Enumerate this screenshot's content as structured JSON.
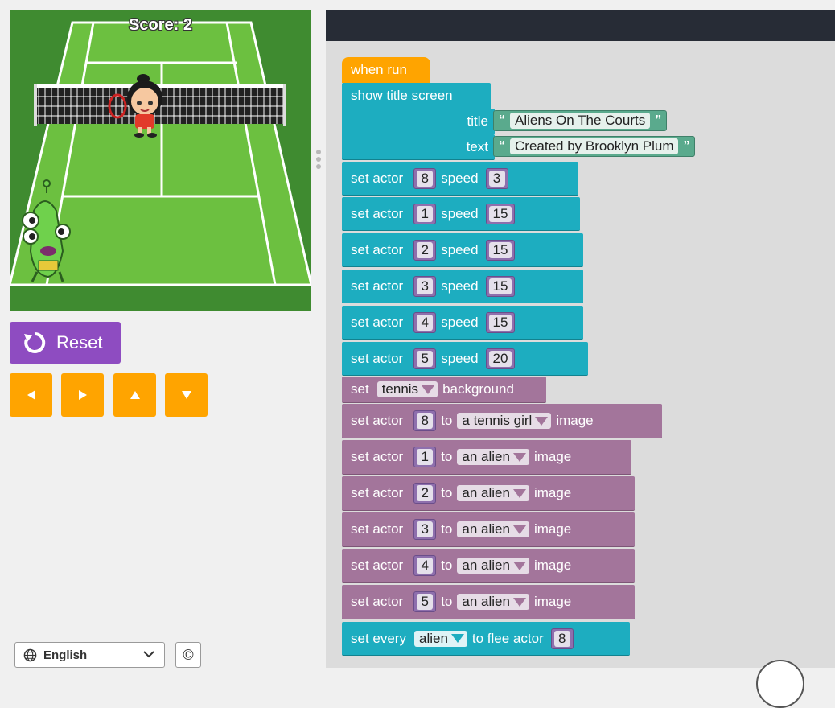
{
  "game": {
    "score": "Score: 2"
  },
  "controls": {
    "reset_label": "Reset",
    "arrows": [
      "left",
      "right",
      "up",
      "down"
    ]
  },
  "footer": {
    "language": "English",
    "copyright_symbol": "©"
  },
  "program": {
    "hat": "when run",
    "title_screen": {
      "label": "show title screen",
      "title_label": "title",
      "title_value": "Aliens On The Courts",
      "text_label": "text",
      "text_value": "Created by Brooklyn Plum"
    },
    "speed_blocks": [
      {
        "label": "set actor",
        "actor": "8",
        "speed_label": "speed",
        "speed": "3"
      },
      {
        "label": "set actor",
        "actor": "1",
        "speed_label": "speed",
        "speed": "15"
      },
      {
        "label": "set actor",
        "actor": "2",
        "speed_label": "speed",
        "speed": "15"
      },
      {
        "label": "set actor",
        "actor": "3",
        "speed_label": "speed",
        "speed": "15"
      },
      {
        "label": "set actor",
        "actor": "4",
        "speed_label": "speed",
        "speed": "15"
      },
      {
        "label": "set actor",
        "actor": "5",
        "speed_label": "speed",
        "speed": "20"
      }
    ],
    "background_block": {
      "label": "set",
      "value": "tennis",
      "suffix": "background"
    },
    "image_blocks": [
      {
        "label": "set actor",
        "actor": "8",
        "to": "to",
        "image": "a tennis girl",
        "suffix": "image"
      },
      {
        "label": "set actor",
        "actor": "1",
        "to": "to",
        "image": "an alien",
        "suffix": "image"
      },
      {
        "label": "set actor",
        "actor": "2",
        "to": "to",
        "image": "an alien",
        "suffix": "image"
      },
      {
        "label": "set actor",
        "actor": "3",
        "to": "to",
        "image": "an alien",
        "suffix": "image"
      },
      {
        "label": "set actor",
        "actor": "4",
        "to": "to",
        "image": "an alien",
        "suffix": "image"
      },
      {
        "label": "set actor",
        "actor": "5",
        "to": "to",
        "image": "an alien",
        "suffix": "image"
      }
    ],
    "flee_block": {
      "label": "set every",
      "value": "alien",
      "middle": "to flee actor",
      "actor": "8"
    }
  },
  "colors": {
    "teal": "#1dadc0",
    "purple": "#a3759b",
    "orange": "#ffa400",
    "green": "#5aaa8d",
    "reset": "#8e4cc1"
  }
}
